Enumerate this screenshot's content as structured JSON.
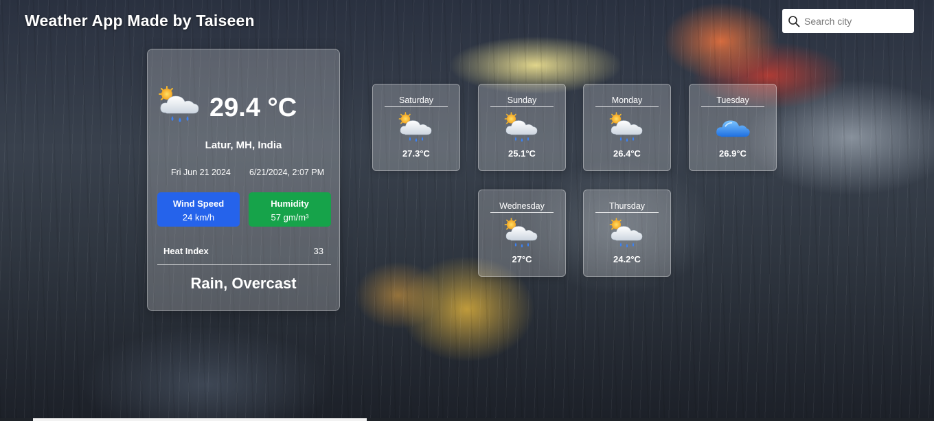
{
  "header": {
    "title": "Weather App Made by Taiseen",
    "search_placeholder": "Search city",
    "search_icon": "search-icon"
  },
  "current": {
    "icon": "sun-behind-rain-cloud-icon",
    "temperature": "29.4 °C",
    "location": "Latur, MH, India",
    "date_short": "Fri Jun 21 2024",
    "date_long": "6/21/2024, 2:07 PM",
    "wind": {
      "label": "Wind Speed",
      "value": "24 km/h",
      "color": "#2563eb"
    },
    "humidity": {
      "label": "Humidity",
      "value": "57 gm/m³",
      "color": "#16a34a"
    },
    "heat_index": {
      "label": "Heat Index",
      "value": "33"
    },
    "condition": "Rain, Overcast"
  },
  "forecast": [
    {
      "day": "Saturday",
      "temp": "27.3°C",
      "icon": "sun-behind-rain-cloud-icon"
    },
    {
      "day": "Sunday",
      "temp": "25.1°C",
      "icon": "sun-behind-rain-cloud-icon"
    },
    {
      "day": "Monday",
      "temp": "26.4°C",
      "icon": "sun-behind-rain-cloud-icon"
    },
    {
      "day": "Tuesday",
      "temp": "26.9°C",
      "icon": "cloud-icon"
    },
    {
      "day": "Wednesday",
      "temp": "27°C",
      "icon": "sun-behind-rain-cloud-icon"
    },
    {
      "day": "Thursday",
      "temp": "24.2°C",
      "icon": "sun-behind-rain-cloud-icon"
    }
  ]
}
